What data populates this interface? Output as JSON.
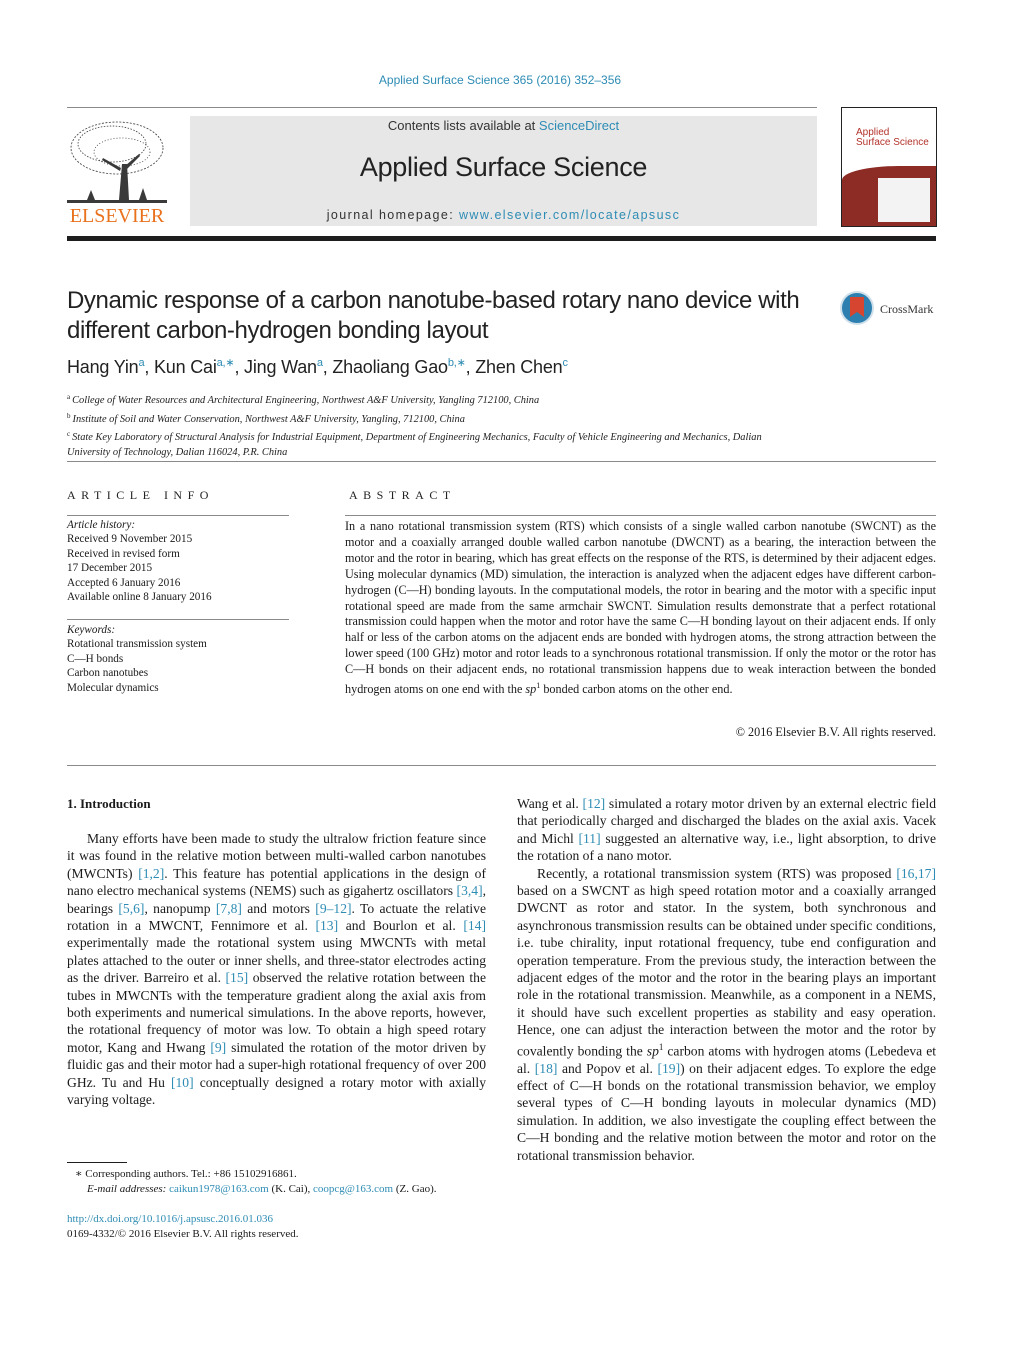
{
  "header": {
    "citation": "Applied Surface Science 365 (2016) 352–356",
    "contents_prefix": "Contents lists available at ",
    "contents_link": "ScienceDirect",
    "journal_name": "Applied Surface Science",
    "homepage_prefix": "journal homepage: ",
    "homepage_link": "www.elsevier.com/locate/apsusc",
    "publisher_logo_text": "ELSEVIER",
    "cover_title_line1": "Applied",
    "cover_title_line2": "Surface Science",
    "crossmark_label": "CrossMark"
  },
  "colors": {
    "link": "#2e8cb4",
    "elsevier_orange": "#e9711c",
    "cover_red": "#8d2b25",
    "banner_gray": "#e7e7e7"
  },
  "article": {
    "title": "Dynamic response of a carbon nanotube-based rotary nano device with different carbon-hydrogen bonding layout",
    "authors": [
      {
        "name": "Hang Yin",
        "sup": "a"
      },
      {
        "name": "Kun Cai",
        "sup": "a,∗"
      },
      {
        "name": "Jing Wan",
        "sup": "a"
      },
      {
        "name": "Zhaoliang Gao",
        "sup": "b,∗"
      },
      {
        "name": "Zhen Chen",
        "sup": "c"
      }
    ],
    "affiliations": [
      {
        "key": "a",
        "text": "College of Water Resources and Architectural Engineering, Northwest A&F University, Yangling 712100, China"
      },
      {
        "key": "b",
        "text": "Institute of Soil and Water Conservation, Northwest A&F University, Yangling, 712100, China"
      },
      {
        "key": "c",
        "text": "State Key Laboratory of Structural Analysis for Industrial Equipment, Department of Engineering Mechanics, Faculty of Vehicle Engineering and Mechanics, Dalian University of Technology, Dalian 116024, P.R. China"
      }
    ]
  },
  "article_info": {
    "heading": "ARTICLE INFO",
    "history_label": "Article history:",
    "history": [
      "Received 9 November 2015",
      "Received in revised form",
      "17 December 2015",
      "Accepted 6 January 2016",
      "Available online 8 January 2016"
    ],
    "keywords_label": "Keywords:",
    "keywords": [
      "Rotational transmission system",
      "C—H bonds",
      "Carbon nanotubes",
      "Molecular dynamics"
    ]
  },
  "abstract": {
    "heading": "ABSTRACT",
    "text_before_sup": "In a nano rotational transmission system (RTS) which consists of a single walled carbon nanotube (SWCNT) as the motor and a coaxially arranged double walled carbon nanotube (DWCNT) as a bearing, the interaction between the motor and the rotor in bearing, which has great effects on the response of the RTS, is determined by their adjacent edges. Using molecular dynamics (MD) simulation, the interaction is analyzed when the adjacent edges have different carbon-hydrogen (C—H) bonding layouts. In the computational models, the rotor in bearing and the motor with a specific input rotational speed are made from the same armchair SWCNT. Simulation results demonstrate that a perfect rotational transmission could happen when the motor and rotor have the same C—H bonding layout on their adjacent ends. If only half or less of the carbon atoms on the adjacent ends are bonded with hydrogen atoms, the strong attraction between the lower speed (100 GHz) motor and rotor leads to a synchronous rotational transmission. If only the motor or the rotor has C—H bonds on their adjacent ends, no rotational transmission happens due to weak interaction between the bonded hydrogen atoms on one end with the ",
    "sp": "sp",
    "sup": "1",
    "text_after_sup": " bonded carbon atoms on the other end.",
    "copyright": "© 2016 Elsevier B.V. All rights reserved."
  },
  "body": {
    "section_heading": "1.  Introduction",
    "left_column": [
      {
        "t": "Many efforts have been made to study the ultralow friction feature since it was found in the relative motion between multi-walled carbon nanotubes (MWCNTs) "
      },
      {
        "ref": "[1,2]"
      },
      {
        "t": ". This feature has potential applications in the design of nano electro mechanical systems (NEMS) such as gigahertz oscillators "
      },
      {
        "ref": "[3,4]"
      },
      {
        "t": ", bearings "
      },
      {
        "ref": "[5,6]"
      },
      {
        "t": ", nanopump "
      },
      {
        "ref": "[7,8]"
      },
      {
        "t": " and motors "
      },
      {
        "ref": "[9–12]"
      },
      {
        "t": ". To actuate the relative rotation in a MWCNT, Fennimore et al. "
      },
      {
        "ref": "[13]"
      },
      {
        "t": " and Bourlon et al. "
      },
      {
        "ref": "[14]"
      },
      {
        "t": " experimentally made the rotational system using MWCNTs with metal plates attached to the outer or inner shells, and three-stator electrodes acting as the driver. Barreiro et al. "
      },
      {
        "ref": "[15]"
      },
      {
        "t": " observed the relative rotation between the tubes in MWCNTs with the temperature gradient along the axial axis from both experiments and numerical simulations. In the above reports, however, the rotational frequency of motor was low. To obtain a high speed rotary motor, Kang and Hwang "
      },
      {
        "ref": "[9]"
      },
      {
        "t": " simulated the rotation of the motor driven by fluidic gas and their motor had a super-high rotational frequency of over 200 GHz. Tu and Hu "
      },
      {
        "ref": "[10]"
      },
      {
        "t": " conceptually designed a rotary motor with axially varying voltage."
      }
    ],
    "right_para1": [
      {
        "t": "Wang et al. "
      },
      {
        "ref": "[12]"
      },
      {
        "t": " simulated a rotary motor driven by an external electric field that periodically charged and discharged the blades on the axial axis. Vacek and Michl "
      },
      {
        "ref": "[11]"
      },
      {
        "t": " suggested an alternative way, i.e., light absorption, to drive the rotation of a nano motor."
      }
    ],
    "right_para2": [
      {
        "t": "Recently, a rotational transmission system (RTS) was proposed "
      },
      {
        "ref": "[16,17]"
      },
      {
        "t": " based on a SWCNT as high speed rotation motor and a coaxially arranged DWCNT as rotor and stator. In the system, both synchronous and asynchronous transmission results can be obtained under specific conditions, i.e. tube chirality, input rotational frequency, tube end configuration and operation temperature. From the previous study, the interaction between the adjacent edges of the motor and the rotor in the bearing plays an important role in the rotational transmission. Meanwhile, as a component in a NEMS, it should have such excellent properties as stability and easy operation. Hence, one can adjust the interaction between the motor and the rotor by covalently bonding the "
      },
      {
        "em": "sp"
      },
      {
        "sup": "1"
      },
      {
        "t": " carbon atoms with hydrogen atoms (Lebedeva et al. "
      },
      {
        "ref": "[18]"
      },
      {
        "t": " and Popov et al. "
      },
      {
        "ref": "[19]"
      },
      {
        "t": ") on their adjacent edges. To explore the edge effect of C—H bonds on the rotational transmission behavior, we employ several types of C—H bonding layouts in molecular dynamics (MD) simulation. In addition, we also investigate the coupling effect between the C—H bonding and the relative motion between the motor and rotor on the rotational transmission behavior."
      }
    ]
  },
  "footnote": {
    "star_text": "∗  Corresponding authors. Tel.: +86 15102916861.",
    "email_label": "E-mail addresses: ",
    "email1": "caikun1978@163.com",
    "email1_owner": " (K. Cai), ",
    "email2": "coopcg@163.com",
    "email2_owner": " (Z. Gao).",
    "doi": "http://dx.doi.org/10.1016/j.apsusc.2016.01.036",
    "issn_copyright": "0169-4332/© 2016 Elsevier B.V. All rights reserved."
  }
}
